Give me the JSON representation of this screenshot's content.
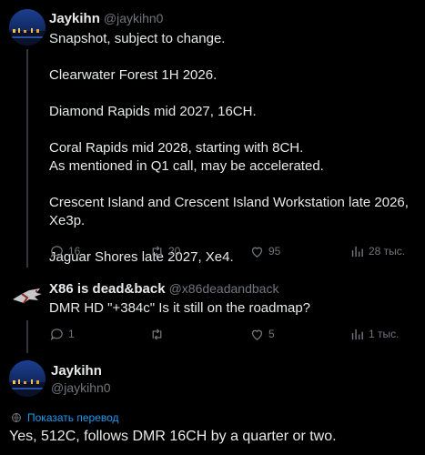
{
  "post1": {
    "author_name": "Jaykihn",
    "author_handle": "@jaykihn0",
    "paragraphs": [
      [
        "Snapshot, subject to change."
      ],
      [
        "Clearwater Forest 1H 2026."
      ],
      [
        "Diamond Rapids mid 2027, 16CH."
      ],
      [
        "Coral Rapids mid 2028, starting with 8CH.",
        "As mentioned in Q1 call, may be accelerated."
      ],
      [
        "Crescent Island and Crescent Island Workstation late 2026, Xe3p."
      ],
      [
        "Jaguar Shores late 2027, Xe4."
      ]
    ],
    "replies": "16",
    "reposts": "20",
    "likes": "95",
    "views": "28 тыс."
  },
  "post2": {
    "author_name": "X86 is dead&back",
    "author_handle": "@x86deadandback",
    "text": "DMR HD \"+384c\" Is it still on the roadmap?",
    "replies": "1",
    "reposts": "",
    "likes": "5",
    "views": "1 тыс."
  },
  "post3": {
    "author_name": "Jaykihn",
    "author_handle": "@jaykihn0",
    "translate_label": "Показать перевод",
    "text": "Yes, 512C, follows DMR 16CH by a quarter or two."
  },
  "colors": {
    "background": "#000000",
    "text": "#e7e9ea",
    "secondary": "#71767b",
    "link": "#1d9bf0",
    "divider": "#2f3336"
  },
  "icons": [
    "reply-icon",
    "repost-icon",
    "like-icon",
    "views-icon",
    "globe-icon"
  ]
}
